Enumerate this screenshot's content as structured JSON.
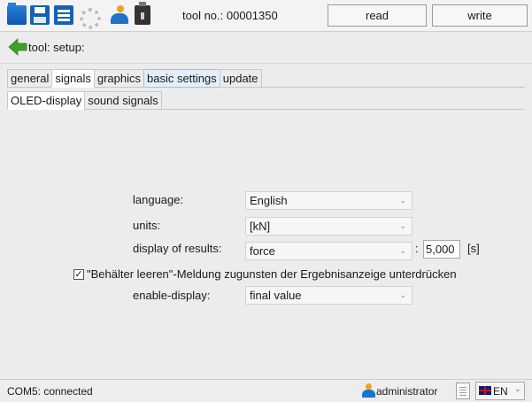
{
  "toolbar": {
    "tool_no": "tool no.: 00001350",
    "read_label": "read",
    "write_label": "write",
    "icons": [
      "folder-icon",
      "save-icon",
      "print-icon",
      "settings-gear-icon",
      "users-icon",
      "usb-icon"
    ]
  },
  "breadcrumb": {
    "text": "tool: setup:",
    "icon": "back-arrow-icon"
  },
  "main_tabs": [
    {
      "label": "general"
    },
    {
      "label": "signals"
    },
    {
      "label": "graphics"
    },
    {
      "label": "basic settings"
    },
    {
      "label": "update"
    }
  ],
  "sub_tabs": [
    {
      "label": "OLED-display"
    },
    {
      "label": "sound signals"
    }
  ],
  "form": {
    "language_label": "language:",
    "language_value": "English",
    "units_label": "units:",
    "units_value": "[kN]",
    "results_label": "display of results:",
    "results_value": "force",
    "colon": ":",
    "results_time": "5,000",
    "results_unit": "[s]",
    "checkbox_checked": true,
    "checkbox_label": "\"Behälter leeren\"-Meldung zugunsten der Ergebnisanzeige unterdrücken",
    "enable_label": "enable-display:",
    "enable_value": "final value"
  },
  "status": {
    "connection": "COM5: connected",
    "user": "administrator",
    "language_code": "EN"
  },
  "colors": {
    "accent_tab": "#e3effa",
    "toolbar_blue": "#1761b4",
    "arrow_green": "#3ea02a"
  }
}
